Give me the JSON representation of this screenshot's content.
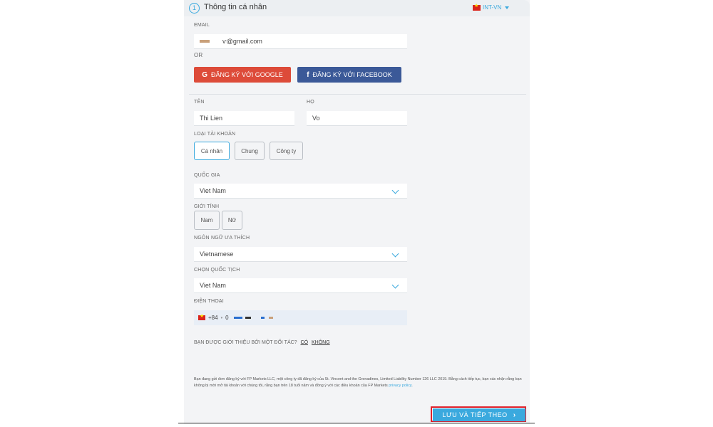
{
  "header": {
    "step": "1",
    "title": "Thông tin cá nhân",
    "language": "INT-VN"
  },
  "email": {
    "label": "EMAIL",
    "value": "ѵ@gmail.com"
  },
  "or_label": "OR",
  "social": {
    "google_label": "ĐĂNG KÝ VỚI GOOGLE",
    "facebook_label": "ĐĂNG KÝ VỚI FACEBOOK"
  },
  "name": {
    "first_label": "TÊN",
    "first_value": "Thi Lien",
    "last_label": "HỌ",
    "last_value": "Vo"
  },
  "account_type": {
    "label": "LOẠI TÀI KHOẢN",
    "options": [
      "Cá nhân",
      "Chung",
      "Công ty"
    ],
    "selected": "Cá nhân"
  },
  "country": {
    "label": "QUỐC GIA",
    "value": "Viet Nam"
  },
  "gender": {
    "label": "GIỚI TÍNH",
    "options": [
      "Nam",
      "Nữ"
    ]
  },
  "language_pref": {
    "label": "NGÔN NGỮ ƯA THÍCH",
    "value": "Vietnamese"
  },
  "nationality": {
    "label": "CHỌN QUỐC TỊCH",
    "value": "Viet Nam"
  },
  "phone": {
    "label": "ĐIỆN THOẠI",
    "code": "+84",
    "value": "0"
  },
  "referral": {
    "question": "BẠN ĐƯỢC GIỚI THIỆU BỞI MỘT ĐỐI TÁC?",
    "yes": "CÓ",
    "no": "KHÔNG"
  },
  "legal": {
    "text": "Bạn đang gửi đơn đăng ký với FP Markets LLC, một công ty đã đăng ký của St. Vincent and the Grenadines, Limited Liability Number 126 LLC 2019. Bằng cách tiếp tục, bạn xác nhận rằng bạn không bị mời mở tài khoản với chúng tôi, rằng bạn trên 18 tuổi năm và đồng ý với các điều khoản của FP Markets ",
    "link": "privacy policy",
    "end": "."
  },
  "submit_label": "LƯU VÀ TIẾP THEO",
  "colors": {
    "accent": "#3aa9de",
    "google": "#dd4b39",
    "facebook": "#3b5998",
    "highlight": "#e0202a"
  }
}
